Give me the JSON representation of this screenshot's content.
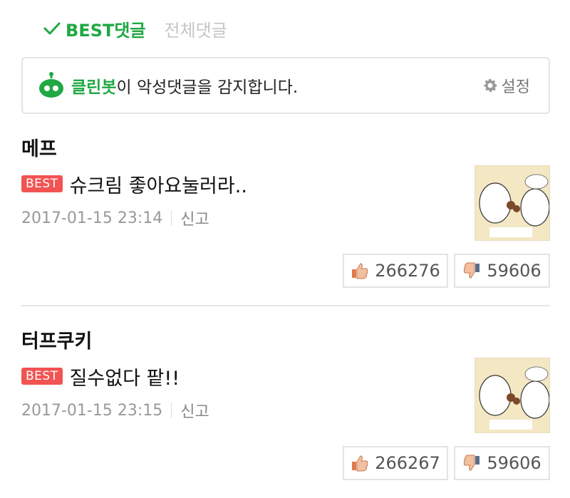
{
  "tabs": {
    "best_label": "BEST댓글",
    "all_label": "전체댓글"
  },
  "cleanbot": {
    "brand": "클린봇",
    "message": "이 악성댓글을 감지합니다.",
    "settings_label": "설정"
  },
  "comments": [
    {
      "nickname": "메프",
      "badge": "BEST",
      "text": "슈크림 좋아요눌러라..",
      "date": "2017-01-15 23:14",
      "report": "신고",
      "likes": "266276",
      "dislikes": "59606"
    },
    {
      "nickname": "터프쿠키",
      "badge": "BEST",
      "text": "질수없다 팥!!",
      "date": "2017-01-15 23:15",
      "report": "신고",
      "likes": "266267",
      "dislikes": "59606"
    }
  ],
  "colors": {
    "accent": "#1fa843",
    "best_badge": "#f25353"
  },
  "icons": {
    "check": "check-icon",
    "bot": "cleanbot-icon",
    "settings": "gear-icon",
    "like": "thumbs-up-icon",
    "dislike": "thumbs-down-icon"
  }
}
